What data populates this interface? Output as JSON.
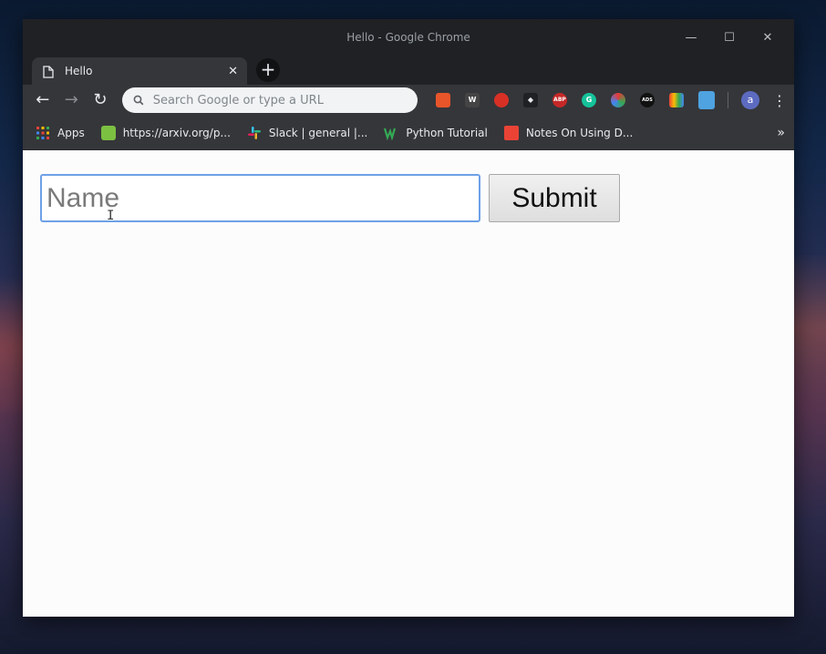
{
  "window": {
    "title": "Hello - Google Chrome",
    "controls": {
      "minimize": "—",
      "maximize": "☐",
      "close": "✕"
    }
  },
  "tab": {
    "title": "Hello",
    "close": "✕",
    "new_tab": "+"
  },
  "toolbar": {
    "back": "←",
    "forward": "→",
    "reload": "↻",
    "omnibox_placeholder": "Search Google or type a URL",
    "avatar_letter": "a",
    "menu": "⋮",
    "extensions": [
      {
        "name": "extension-b-icon",
        "label": "",
        "color": "#e8552a"
      },
      {
        "name": "extension-w-icon",
        "label": "W",
        "color": "#444444"
      },
      {
        "name": "extension-hand-icon",
        "label": "",
        "color": "#d93025"
      },
      {
        "name": "extension-cat-icon",
        "label": "",
        "color": "#202124"
      },
      {
        "name": "extension-abp-icon",
        "label": "ABP",
        "color": "#c62828"
      },
      {
        "name": "extension-grammarly-icon",
        "label": "G",
        "color": "#15c39a"
      },
      {
        "name": "extension-ring-icon",
        "label": "",
        "color": "#e53935"
      },
      {
        "name": "extension-ads-icon",
        "label": "ADS",
        "color": "#111111"
      },
      {
        "name": "extension-palette-icon",
        "label": "",
        "color": "#fbbc04"
      },
      {
        "name": "extension-pdf-icon",
        "label": "",
        "color": "#4fa3e0"
      }
    ]
  },
  "bookmarks": {
    "items": [
      {
        "label": "Apps",
        "color": "#4285f4"
      },
      {
        "label": "https://arxiv.org/p...",
        "color": "#7cc042"
      },
      {
        "label": "Slack | general |...",
        "color": "#e01e5a"
      },
      {
        "label": "Python Tutorial",
        "color": "#34a853"
      },
      {
        "label": "Notes On Using D...",
        "color": "#ea4335"
      }
    ],
    "more": "»"
  },
  "form": {
    "name_placeholder": "Name",
    "submit_label": "Submit"
  }
}
